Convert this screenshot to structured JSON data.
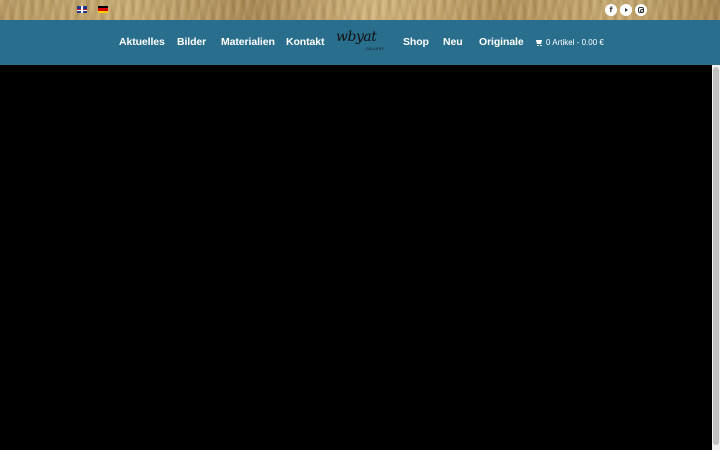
{
  "topbar": {
    "languages": [
      {
        "code": "en",
        "icon": "uk-flag-icon"
      },
      {
        "code": "de",
        "icon": "de-flag-icon"
      }
    ],
    "social": [
      {
        "name": "facebook",
        "icon": "facebook-icon",
        "glyph": "f"
      },
      {
        "name": "youtube",
        "icon": "youtube-icon"
      },
      {
        "name": "instagram",
        "icon": "instagram-icon"
      }
    ]
  },
  "nav": {
    "items": [
      "Aktuelles",
      "Bilder",
      "Materialien",
      "Kontakt",
      "Shop",
      "Neu",
      "Originale"
    ],
    "logo": {
      "text": "wbyat",
      "sub": "GALLERY"
    },
    "cart": {
      "label": "0 Artikel - 0.00 €",
      "icon": "cart-icon"
    }
  },
  "colors": {
    "nav_bg": "#2a6e8d",
    "nav_text": "#ffffff",
    "hero_bg": "#000000",
    "topbar_gold": "#b89a63"
  }
}
